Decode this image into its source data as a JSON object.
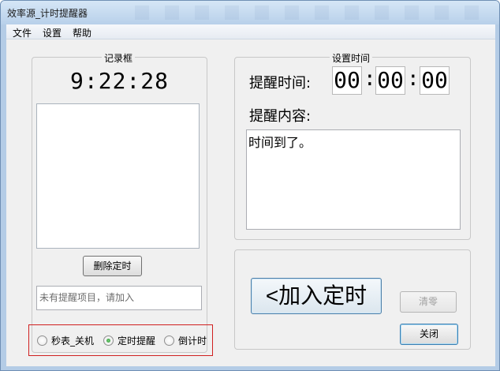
{
  "window": {
    "title": "效率源_计时提醒器"
  },
  "menu": [
    "文件",
    "设置",
    "帮助"
  ],
  "record": {
    "legend": "记录框",
    "clock": "9:22:28",
    "delete_button": "删除定时",
    "status_placeholder": "未有提醒项目，请加入"
  },
  "modes": {
    "options": [
      "秒表_关机",
      "定时提醒",
      "倒计时"
    ],
    "selected": "定时提醒"
  },
  "settings": {
    "legend": "设置时间",
    "time_label": "提醒时间:",
    "hours": "00",
    "minutes": "00",
    "seconds": "00",
    "colon": ":",
    "content_label": "提醒内容:",
    "content_value": "时间到了。"
  },
  "actions": {
    "add_button": "<加入定时",
    "clear_button": "清零",
    "close_button": "关闭"
  }
}
